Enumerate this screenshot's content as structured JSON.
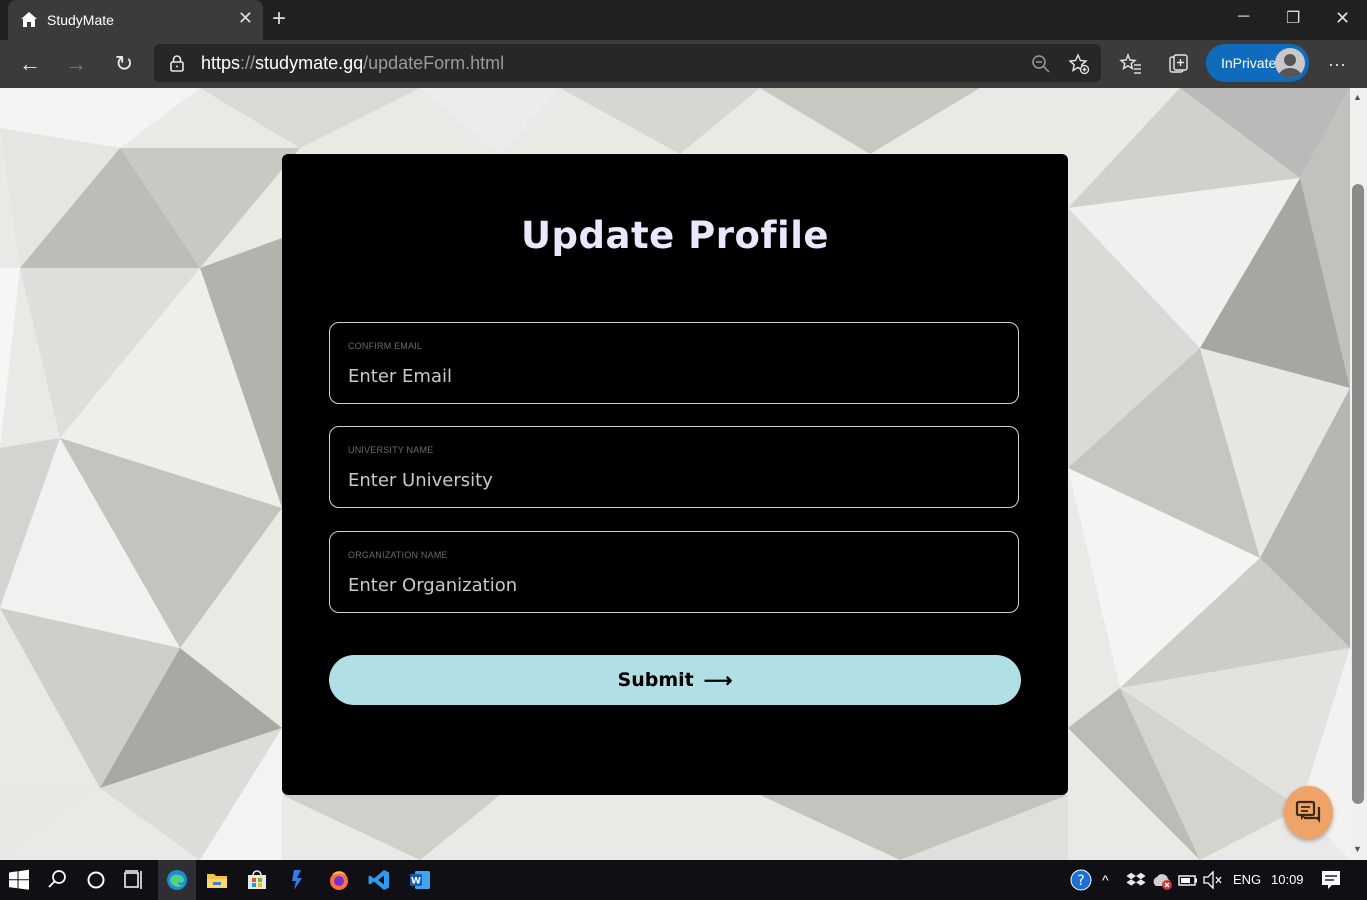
{
  "browser": {
    "tab": {
      "title": "StudyMate",
      "icon": "home-icon"
    },
    "address": {
      "scheme": "https",
      "sep": "://",
      "host": "studymate.gq",
      "path": "/updateForm.html"
    },
    "profile_label": "InPrivate",
    "accent": "#0f6cbd"
  },
  "form": {
    "title": "Update Profile",
    "fields": [
      {
        "label": "CONFIRM EMAIL",
        "placeholder": "Enter Email"
      },
      {
        "label": "UNIVERSITY NAME",
        "placeholder": "Enter University"
      },
      {
        "label": "ORGANIZATION NAME",
        "placeholder": "Enter Organization"
      }
    ],
    "submit_label": "Submit",
    "submit_icon": "arrow-right-icon",
    "button_color": "#b0dfe5",
    "title_color": "#ebe7ff"
  },
  "chat_widget": {
    "icon": "chat-icon",
    "color": "#f0a366"
  },
  "taskbar": {
    "language": "ENG",
    "clock": "10:09",
    "apps": [
      "start-icon",
      "search-icon",
      "cortana-icon",
      "task-view-icon",
      "edge-icon",
      "file-explorer-icon",
      "store-icon",
      "power-automate-icon",
      "firefox-icon",
      "vscode-icon",
      "word-icon"
    ]
  }
}
